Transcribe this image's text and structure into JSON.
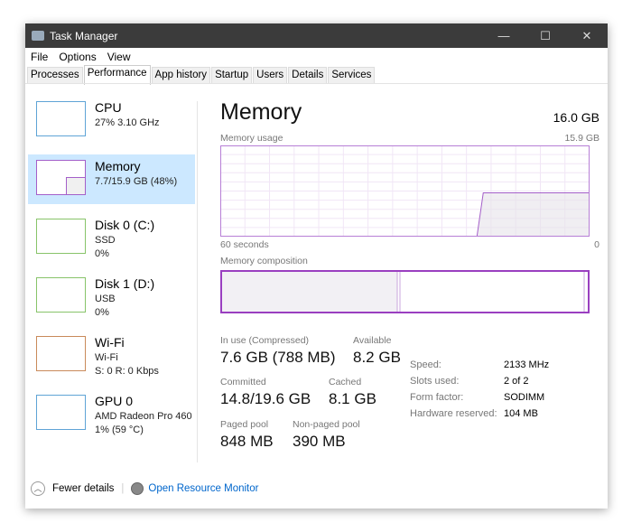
{
  "window": {
    "title": "Task Manager",
    "controls": [
      "—",
      "☐",
      "✕"
    ]
  },
  "menu": [
    "File",
    "Options",
    "View"
  ],
  "tabs": [
    {
      "label": "Processes"
    },
    {
      "label": "Performance",
      "active": true
    },
    {
      "label": "App history"
    },
    {
      "label": "Startup"
    },
    {
      "label": "Users"
    },
    {
      "label": "Details"
    },
    {
      "label": "Services"
    }
  ],
  "sidebar": [
    {
      "name": "CPU",
      "l1": "27%  3.10 GHz",
      "l2": "",
      "color": "#5fa4d6"
    },
    {
      "name": "Memory",
      "l1": "7.7/15.9 GB (48%)",
      "l2": "",
      "color": "#a45fc9",
      "selected": true
    },
    {
      "name": "Disk 0 (C:)",
      "l1": "SSD",
      "l2": "0%",
      "color": "#88c46a"
    },
    {
      "name": "Disk 1 (D:)",
      "l1": "USB",
      "l2": "0%",
      "color": "#88c46a"
    },
    {
      "name": "Wi-Fi",
      "l1": "Wi-Fi",
      "l2": "S: 0  R: 0 Kbps",
      "color": "#c98a5a"
    },
    {
      "name": "GPU 0",
      "l1": "AMD Radeon Pro 460",
      "l2": "1%  (59 °C)",
      "color": "#5fa4d6"
    }
  ],
  "main": {
    "title": "Memory",
    "total": "16.0 GB",
    "usage_label": "Memory usage",
    "usage_max": "15.9 GB",
    "x_left": "60 seconds",
    "x_right": "0",
    "usage_percent": 48,
    "composition_label": "Memory composition",
    "stats": {
      "in_use_label": "In use (Compressed)",
      "in_use": "7.6 GB (788 MB)",
      "available_label": "Available",
      "available": "8.2 GB",
      "committed_label": "Committed",
      "committed": "14.8/19.6 GB",
      "cached_label": "Cached",
      "cached": "8.1 GB",
      "paged_label": "Paged pool",
      "paged": "848 MB",
      "nonpaged_label": "Non-paged pool",
      "nonpaged": "390 MB"
    },
    "specs": [
      {
        "k": "Speed:",
        "v": "2133 MHz"
      },
      {
        "k": "Slots used:",
        "v": "2 of 2"
      },
      {
        "k": "Form factor:",
        "v": "SODIMM"
      },
      {
        "k": "Hardware reserved:",
        "v": "104 MB"
      }
    ]
  },
  "footer": {
    "fewer": "Fewer details",
    "monitor": "Open Resource Monitor"
  },
  "colors": {
    "accent": "#a45fc9",
    "link": "#0066cc",
    "selected": "#cce8ff"
  }
}
